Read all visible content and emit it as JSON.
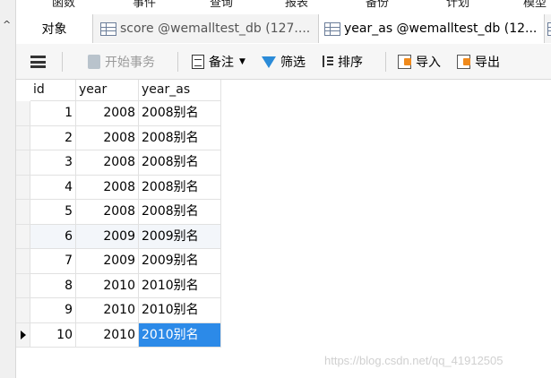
{
  "menu": [
    "函数",
    "事件",
    "查询",
    "报表",
    "备份",
    "计划",
    "模型"
  ],
  "tabs": {
    "objects": "对象",
    "tab1": "score @wemalltest_db (127....",
    "tab2": "year_as @wemalltest_db (12...",
    "tab3": ""
  },
  "toolbar": {
    "begin_transaction": "开始事务",
    "memo": "备注",
    "filter": "筛选",
    "sort": "排序",
    "import": "导入",
    "export": "导出"
  },
  "table": {
    "columns": [
      "id",
      "year",
      "year_as"
    ],
    "rows": [
      {
        "id": "1",
        "year": "2008",
        "year_as": "2008别名"
      },
      {
        "id": "2",
        "year": "2008",
        "year_as": "2008别名"
      },
      {
        "id": "3",
        "year": "2008",
        "year_as": "2008别名"
      },
      {
        "id": "4",
        "year": "2008",
        "year_as": "2008别名"
      },
      {
        "id": "5",
        "year": "2008",
        "year_as": "2008别名"
      },
      {
        "id": "6",
        "year": "2009",
        "year_as": "2009别名"
      },
      {
        "id": "7",
        "year": "2009",
        "year_as": "2009别名"
      },
      {
        "id": "8",
        "year": "2010",
        "year_as": "2010别名"
      },
      {
        "id": "9",
        "year": "2010",
        "year_as": "2010别名"
      },
      {
        "id": "10",
        "year": "2010",
        "year_as": "2010别名"
      }
    ],
    "current_row": 9,
    "highlight_row": 5
  },
  "watermark": "https://blog.csdn.net/qq_41912505",
  "colors": {
    "selection": "#2c8ae8",
    "filter_icon": "#2b8bd8",
    "import_export_icon": "#f08a1c"
  }
}
